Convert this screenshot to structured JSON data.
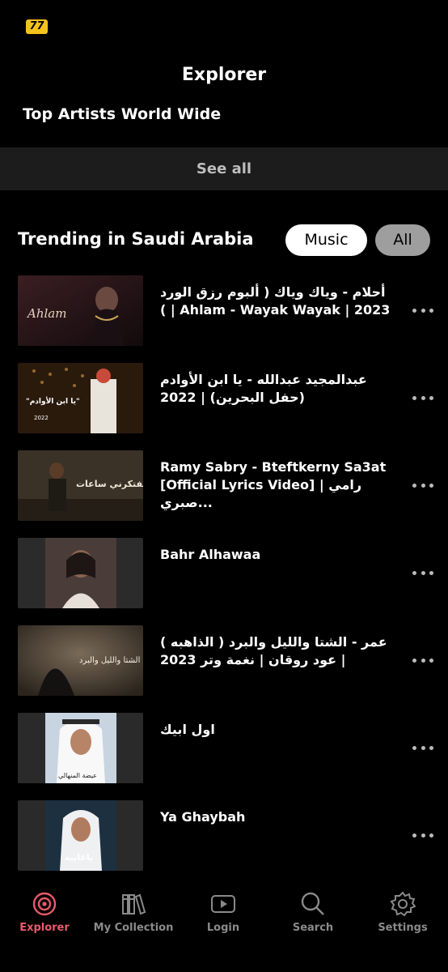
{
  "status": {
    "badge": "77"
  },
  "header": {
    "title": "Explorer"
  },
  "top_artists": {
    "title": "Top Artists World Wide",
    "see_all": "See all"
  },
  "trending": {
    "title": "Trending in Saudi Arabia",
    "filters": {
      "music": "Music",
      "all": "All"
    },
    "items": [
      {
        "title": "أحلام - وياك وياك ( ألبوم رزق الورد ) | Ahlam - Wayak Wayak | 2023",
        "thumb_text": "Ahlam"
      },
      {
        "title": "عبدالمجيد عبدالله - يا ابن الأوادم (حفل البحرين) | 2022",
        "thumb_text": "\"يا ابن الأوادم\""
      },
      {
        "title": "Ramy Sabry - Bteftkerny Sa3at [Official Lyrics Video] | رامي صبري...",
        "thumb_text": "بتفتكرني ساعات"
      },
      {
        "title": "Bahr Alhawaa",
        "thumb_text": ""
      },
      {
        "title": "عمر - الشتا والليل والبرد ( الذاهبه ) | عود روقان | نغمة وتر 2023",
        "thumb_text": "الشتا والليل والبرد"
      },
      {
        "title": "اول ابيك",
        "thumb_text": "عيضة المنهالي"
      },
      {
        "title": "Ya Ghaybah",
        "thumb_text": "ياغايبه"
      }
    ]
  },
  "tabs": [
    {
      "label": "Explorer",
      "icon": "explorer-target-icon",
      "active": true
    },
    {
      "label": "My Collection",
      "icon": "library-books-icon",
      "active": false
    },
    {
      "label": "Login",
      "icon": "play-screen-icon",
      "active": false
    },
    {
      "label": "Search",
      "icon": "search-icon",
      "active": false
    },
    {
      "label": "Settings",
      "icon": "gear-icon",
      "active": false
    }
  ],
  "colors": {
    "accent": "#e85a6a",
    "see_all_bg": "#1c1c1c",
    "badge": "#f4c21c"
  }
}
